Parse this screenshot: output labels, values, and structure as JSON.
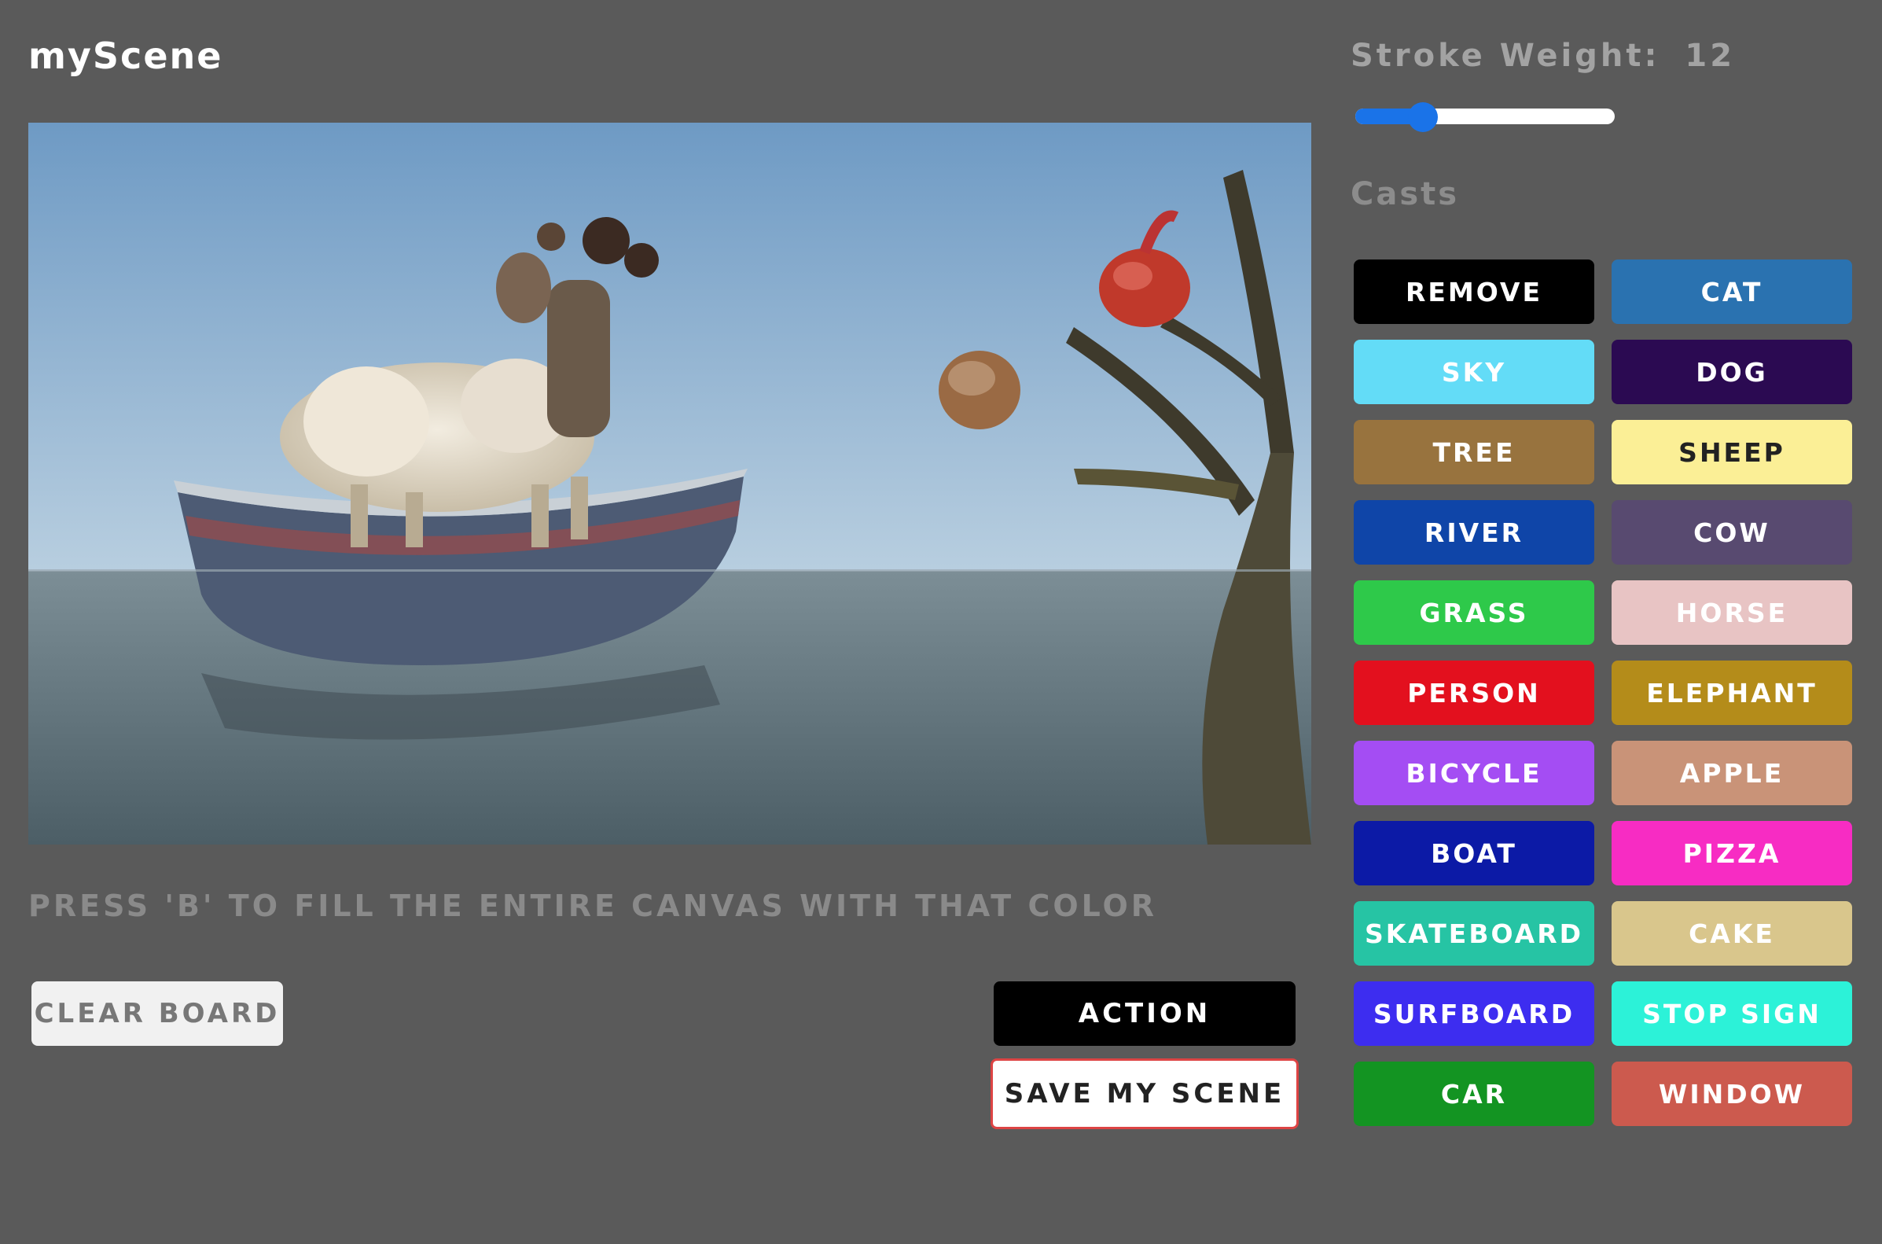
{
  "app": {
    "title": "myScene"
  },
  "canvas": {
    "hint": "PRESS 'B' TO FILL THE ENTIRE CANVAS WITH THAT COLOR"
  },
  "buttons": {
    "clear": "CLEAR BOARD",
    "action": "ACTION",
    "save": "SAVE MY SCENE"
  },
  "stroke": {
    "label": "Stroke Weight:",
    "value": "12",
    "slider_fraction": 0.26
  },
  "casts": {
    "label": "Casts",
    "items": [
      {
        "label": "REMOVE",
        "color": "#000000",
        "text_color": "#ffffff"
      },
      {
        "label": "CAT",
        "color": "#2a72b0",
        "text_color": "#ffffff"
      },
      {
        "label": "SKY",
        "color": "#63dcf7",
        "text_color": "#ffffff"
      },
      {
        "label": "DOG",
        "color": "#2b0a52",
        "text_color": "#ffffff"
      },
      {
        "label": "TREE",
        "color": "#98733e",
        "text_color": "#ffffff"
      },
      {
        "label": "SHEEP",
        "color": "#fbef96",
        "text_color": "#222222"
      },
      {
        "label": "RIVER",
        "color": "#0f45a8",
        "text_color": "#ffffff"
      },
      {
        "label": "COW",
        "color": "#584a70",
        "text_color": "#ffffff"
      },
      {
        "label": "GRASS",
        "color": "#2ec94a",
        "text_color": "#ffffff"
      },
      {
        "label": "HORSE",
        "color": "#e8c4c4",
        "text_color": "#ffffff"
      },
      {
        "label": "PERSON",
        "color": "#e3101e",
        "text_color": "#ffffff"
      },
      {
        "label": "ELEPHANT",
        "color": "#b48c1a",
        "text_color": "#ffffff"
      },
      {
        "label": "BICYCLE",
        "color": "#a44df3",
        "text_color": "#ffffff"
      },
      {
        "label": "APPLE",
        "color": "#c99378",
        "text_color": "#ffffff"
      },
      {
        "label": "BOAT",
        "color": "#0c1aa6",
        "text_color": "#ffffff"
      },
      {
        "label": "PIZZA",
        "color": "#f72cc3",
        "text_color": "#ffffff"
      },
      {
        "label": "SKATEBOARD",
        "color": "#26c4a4",
        "text_color": "#ffffff"
      },
      {
        "label": "CAKE",
        "color": "#d9c68c",
        "text_color": "#ffffff"
      },
      {
        "label": "SURFBOARD",
        "color": "#3d2df0",
        "text_color": "#ffffff"
      },
      {
        "label": "STOP SIGN",
        "color": "#2cf2d8",
        "text_color": "#ffffff"
      },
      {
        "label": "CAR",
        "color": "#139422",
        "text_color": "#ffffff"
      },
      {
        "label": "WINDOW",
        "color": "#cc5a4e",
        "text_color": "#ffffff"
      }
    ]
  }
}
